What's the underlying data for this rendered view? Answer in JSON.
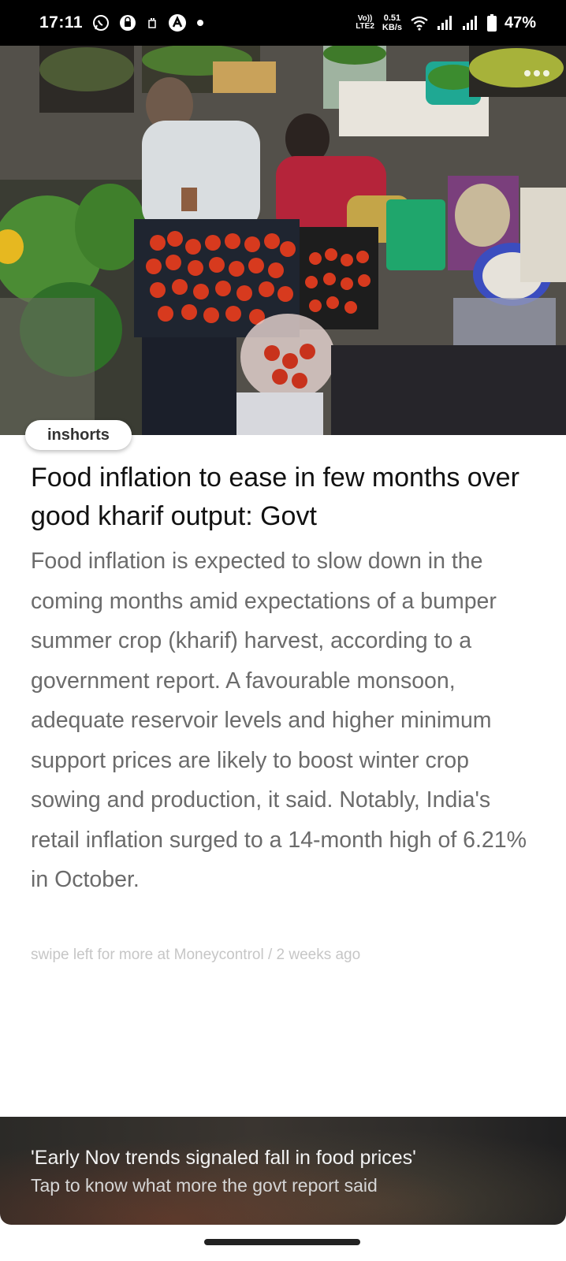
{
  "status_bar": {
    "time": "17:11",
    "network_label_top": "Vo))",
    "network_label_bottom": "LTE2",
    "speed_value": "0.51",
    "speed_unit": "KB/s",
    "battery": "47%",
    "icons": [
      "whatsapp-icon",
      "notification-icon",
      "sim-icon",
      "app-icon",
      "dot-icon",
      "wifi-icon",
      "signal-icon",
      "signal-icon",
      "battery-icon"
    ]
  },
  "article": {
    "source_pill": "inshorts",
    "headline": "Food inflation to ease in few months over good kharif output: Govt",
    "body": "Food inflation is expected to slow down in the coming months amid expectations of a bumper summer crop (kharif) harvest, according to a government report. A favourable monsoon, adequate reservoir levels and higher minimum support prices are likely to boost winter crop sowing and production, it said. Notably, India's retail inflation surged to a 14-month high of 6.21% in October.",
    "swipe_text": "swipe left for more at Moneycontrol / 2 weeks ago"
  },
  "banner": {
    "title": "'Early Nov trends signaled fall in food prices'",
    "subtitle": "Tap to know what more the govt report said"
  },
  "colors": {
    "status_bg": "#000000",
    "headline": "#111111",
    "body": "#6b6b6b",
    "meta": "#c6c6c6"
  }
}
